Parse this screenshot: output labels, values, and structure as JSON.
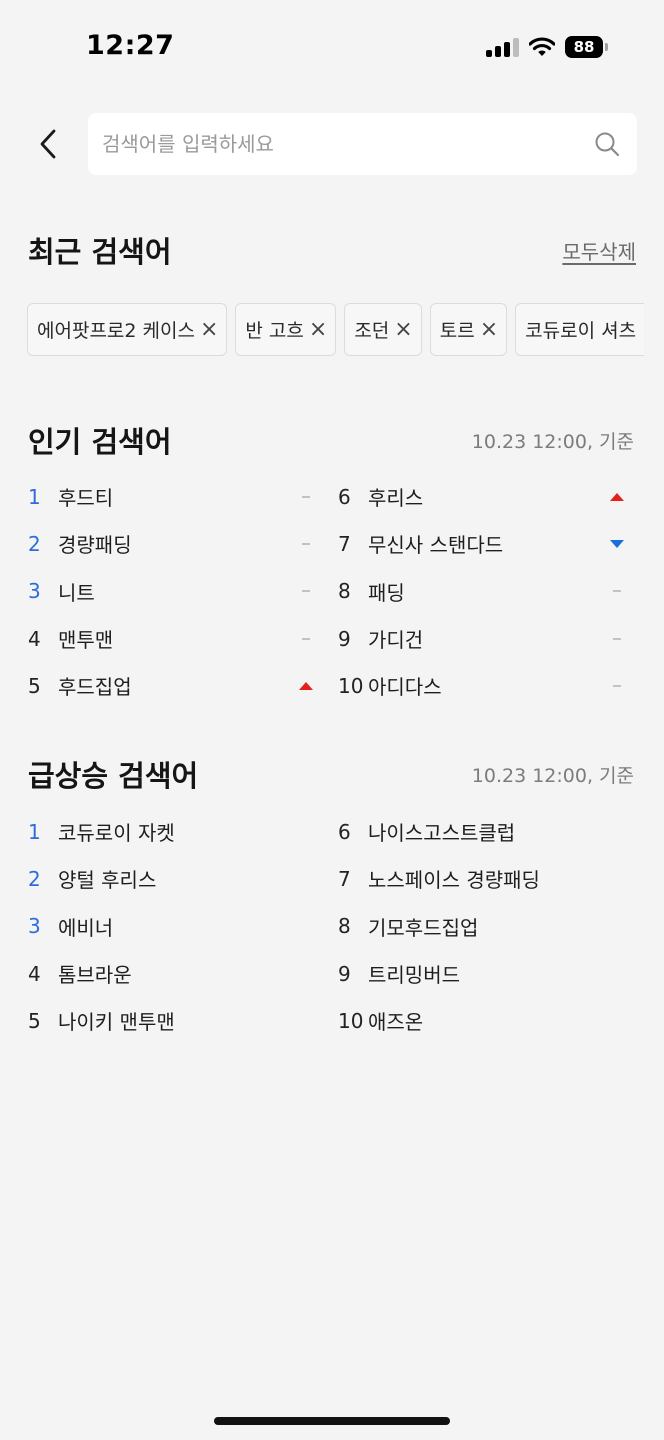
{
  "status_bar": {
    "time": "12:27",
    "battery": "88"
  },
  "search": {
    "placeholder": "검색어를 입력하세요"
  },
  "recent": {
    "title": "최근 검색어",
    "clear_all": "모두삭제",
    "chips": [
      "에어팟프로2 케이스",
      "반 고흐",
      "조던",
      "토르",
      "코듀로이 셔츠"
    ]
  },
  "popular": {
    "title": "인기 검색어",
    "timestamp": "10.23 12:00, 기준",
    "left": [
      {
        "rank": "1",
        "label": "후드티",
        "trend": "same"
      },
      {
        "rank": "2",
        "label": "경량패딩",
        "trend": "same"
      },
      {
        "rank": "3",
        "label": "니트",
        "trend": "same"
      },
      {
        "rank": "4",
        "label": "맨투맨",
        "trend": "same"
      },
      {
        "rank": "5",
        "label": "후드집업",
        "trend": "up"
      }
    ],
    "right": [
      {
        "rank": "6",
        "label": "후리스",
        "trend": "up"
      },
      {
        "rank": "7",
        "label": "무신사 스탠다드",
        "trend": "down"
      },
      {
        "rank": "8",
        "label": "패딩",
        "trend": "same"
      },
      {
        "rank": "9",
        "label": "가디건",
        "trend": "same"
      },
      {
        "rank": "10",
        "label": "아디다스",
        "trend": "same"
      }
    ]
  },
  "rising": {
    "title": "급상승 검색어",
    "timestamp": "10.23 12:00, 기준",
    "left": [
      {
        "rank": "1",
        "label": "코듀로이 자켓"
      },
      {
        "rank": "2",
        "label": "양털 후리스"
      },
      {
        "rank": "3",
        "label": "에비너"
      },
      {
        "rank": "4",
        "label": "톰브라운"
      },
      {
        "rank": "5",
        "label": "나이키 맨투맨"
      }
    ],
    "right": [
      {
        "rank": "6",
        "label": "나이스고스트클럽"
      },
      {
        "rank": "7",
        "label": "노스페이스 경량패딩"
      },
      {
        "rank": "8",
        "label": "기모후드집업"
      },
      {
        "rank": "9",
        "label": "트리밍버드"
      },
      {
        "rank": "10",
        "label": "애즈온"
      }
    ]
  },
  "colors": {
    "top_rank_blue": "#2e6bdc",
    "trend_up": "#e5201b",
    "trend_down": "#1a6fdc",
    "trend_same": "#c2c2c2"
  }
}
